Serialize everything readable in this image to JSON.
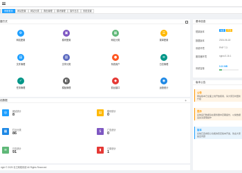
{
  "tabs": [
    {
      "label": "系统首页",
      "active": true
    },
    {
      "label": "网站配置",
      "active": false
    },
    {
      "label": "网站分类",
      "active": false
    },
    {
      "label": "角色管理",
      "active": false
    },
    {
      "label": "模块管理",
      "active": false
    },
    {
      "label": "操作日志",
      "active": false
    },
    {
      "label": "系统设置",
      "active": false
    }
  ],
  "shortcuts": {
    "title": "捷方式",
    "items": [
      {
        "label": "网站配置",
        "color": "#1e9fff",
        "icon": "gear-icon"
      },
      {
        "label": "模块配置",
        "color": "#7e57c2",
        "icon": "cube-icon"
      },
      {
        "label": "网站分类",
        "color": "#5fb878",
        "icon": "grid-icon"
      },
      {
        "label": "菜单配置",
        "color": "#ffb800",
        "icon": "menu-icon"
      },
      {
        "label": "文件管理",
        "color": "#1e9fff",
        "icon": "folder-icon"
      },
      {
        "label": "文章分类",
        "color": "#5c6bc0",
        "icon": "doc-icon"
      },
      {
        "label": "系统用户",
        "color": "#ff5722",
        "icon": "user-icon"
      },
      {
        "label": "日志管理",
        "color": "#009688",
        "icon": "log-icon"
      },
      {
        "label": "任务管理",
        "color": "#009688",
        "icon": "task-icon"
      },
      {
        "label": "模板管理",
        "color": "#616161",
        "icon": "template-icon"
      },
      {
        "label": "前台接口",
        "color": "#e53935",
        "icon": "api-icon"
      },
      {
        "label": "运营统计",
        "color": "#1e88e5",
        "icon": "chart-icon"
      }
    ]
  },
  "stats": {
    "title": "站数据",
    "items": [
      {
        "name": "网站统计",
        "value": "8",
        "color": "#1e9fff",
        "icon": "globe-icon"
      },
      {
        "name": "模块统计",
        "value": "0",
        "color": "#ffb800",
        "icon": "module-icon"
      },
      {
        "name": "栏目分类",
        "value": "86",
        "color": "#1e88e5",
        "icon": "category-icon"
      },
      {
        "name": "广告统计",
        "value": "0",
        "color": "#7e57c2",
        "icon": "ad-icon"
      },
      {
        "name": "日志统计",
        "value": "91",
        "color": "#5fb878",
        "icon": "log-stat-icon"
      },
      {
        "name": "订单统计",
        "value": "1",
        "color": "#e53935",
        "icon": "order-icon"
      }
    ]
  },
  "sysinfo": {
    "title": "基本信息",
    "rows": [
      {
        "label": "框架版本",
        "value": "v1.0"
      },
      {
        "label": "数据版本",
        "value": "2024-06-18"
      },
      {
        "label": "系统环境",
        "value": "PHP 7.3"
      },
      {
        "label": "服务器环境",
        "value": "nginx/1.16.1"
      },
      {
        "label": "系统容量",
        "value": "0.21 MB"
      }
    ],
    "badges": [
      {
        "text": "免费",
        "color": "#1e9fff"
      },
      {
        "text": "开源",
        "color": "#ffb800"
      }
    ],
    "capacity_used": "0.21 MB",
    "capacity_fraction": 0.15
  },
  "notices": {
    "title": "版本公告",
    "items": [
      {
        "title": "公告",
        "body": "网站版本已全面上线开放使用，请大家及时更新升级",
        "color": "#ff9800"
      },
      {
        "title": "提示",
        "body": "系统运行数据请在服务器中定期备份，以免数据丢失请谨慎操作",
        "color": "#ff9800"
      },
      {
        "title": "版本",
        "body": "系统已完成核心功能的稳定版本开发，欢迎大家提出问题",
        "color": "#1e9fff"
      }
    ]
  },
  "footer": {
    "text": "right © 2025 长江网络系统 All Rights Reserved"
  }
}
